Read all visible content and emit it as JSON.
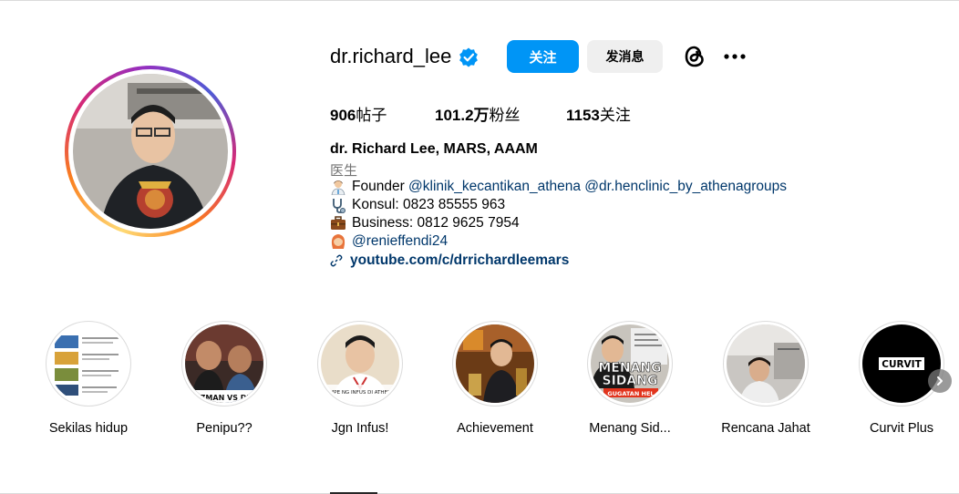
{
  "profile": {
    "username": "dr.richard_lee",
    "follow_label": "关注",
    "message_label": "发消息",
    "stats": {
      "posts_num": "906",
      "posts_label": "帖子",
      "followers_num": "101.2万",
      "followers_label": "粉丝",
      "following_num": "1153",
      "following_label": "关注"
    },
    "bio": {
      "name": "dr. Richard Lee, MARS, AAAM",
      "category": "医生",
      "line1_prefix": "Founder ",
      "line1_mention1": "@klinik_kecantikan_athena",
      "line1_mention2": "@dr.henclinic_by_athenagroups",
      "line2": "Konsul: 0823 85555 963",
      "line3": "Business: 0812 9625 7954",
      "line4_mention": "@renieffendi24",
      "link": "youtube.com/c/drrichardleemars"
    }
  },
  "highlights": [
    {
      "label": "Sekilas hidup"
    },
    {
      "label": "Penipu??"
    },
    {
      "label": "Jgn Infus!"
    },
    {
      "label": "Achievement"
    },
    {
      "label": "Menang Sid..."
    },
    {
      "label": "Rencana Jahat"
    },
    {
      "label": "Curvit Plus"
    }
  ],
  "highlight_cover_text": {
    "h2": "RAZMAN VS DEW",
    "h3": "SAMPE NG INFUS DI ATHENA?",
    "h5a": "MENANG",
    "h5b": "SIDANG",
    "h5c": "GUGATAN HEL",
    "h7": "CURVIT"
  },
  "colors": {
    "primary_blue": "#0095f6",
    "mention_blue": "#00376b",
    "secondary_text": "#737373"
  }
}
